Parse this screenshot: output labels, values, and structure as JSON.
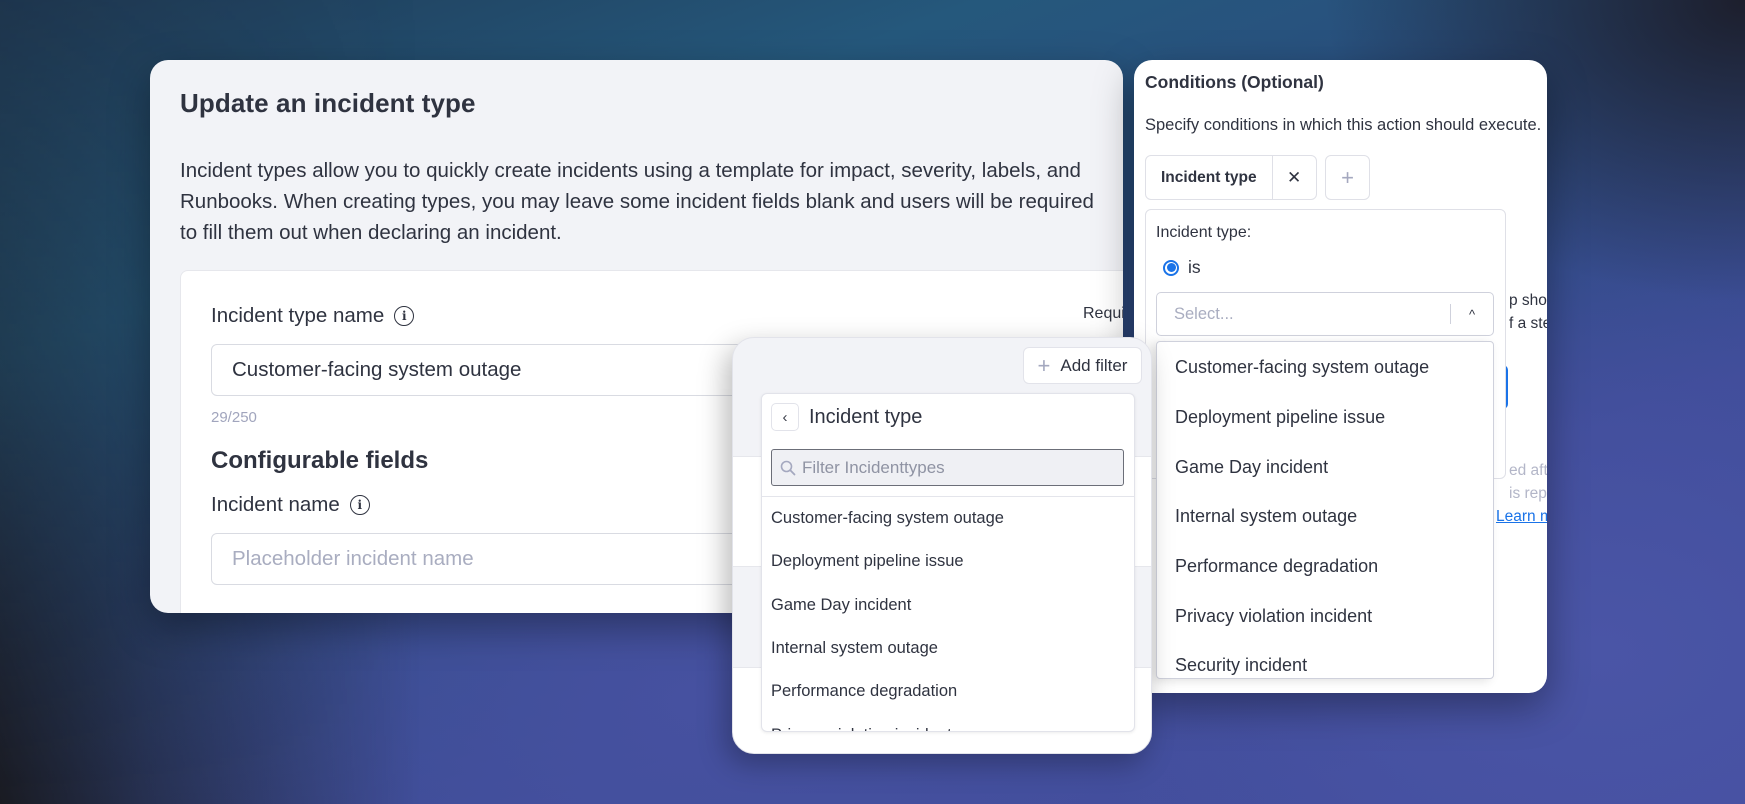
{
  "left_card": {
    "title": "Update an incident type",
    "description": "Incident types allow you to quickly create incidents using a template for impact, severity, labels, and Runbooks. When creating types, you may leave some incident fields blank and users will be required to fill them out when declaring an incident.",
    "type_name_label": "Incident type name",
    "required_label": "Required",
    "type_name_value": "Customer-facing system outage",
    "char_counter": "29/250",
    "configurable_fields_title": "Configurable fields",
    "incident_name_label": "Incident name",
    "incident_name_placeholder": "Placeholder incident name",
    "info_icon_glyph": "i"
  },
  "filter_popover": {
    "add_filter_label": "Add filter",
    "add_filter_icon": "+",
    "back_icon": "‹",
    "panel_title": "Incident type",
    "search_placeholder": "Filter Incidenttypes",
    "search_value": "",
    "items": [
      "Customer-facing system outage",
      "Deployment pipeline issue",
      "Game Day incident",
      "Internal system outage",
      "Performance degradation",
      "Privacy violation incident"
    ]
  },
  "conditions_card": {
    "title": "Conditions (Optional)",
    "description": "Specify conditions in which this action should execute.",
    "chip_label": "Incident type",
    "chip_close_icon": "✕",
    "add_condition_icon": "+",
    "panel_label": "Incident type:",
    "operator_options": [
      {
        "label": "is",
        "selected": true
      }
    ],
    "select_placeholder": "Select...",
    "select_caret": "^",
    "behind_fragments": {
      "line1": "p shou",
      "line2": "f a ste",
      "line3": "ed afte",
      "line4": "is repea",
      "link": "Learn m"
    },
    "options": [
      "Customer-facing system outage",
      "Deployment pipeline issue",
      "Game Day incident",
      "Internal system outage",
      "Performance degradation",
      "Privacy violation incident",
      "Security incident"
    ],
    "accent_color": "#1a73e8"
  }
}
